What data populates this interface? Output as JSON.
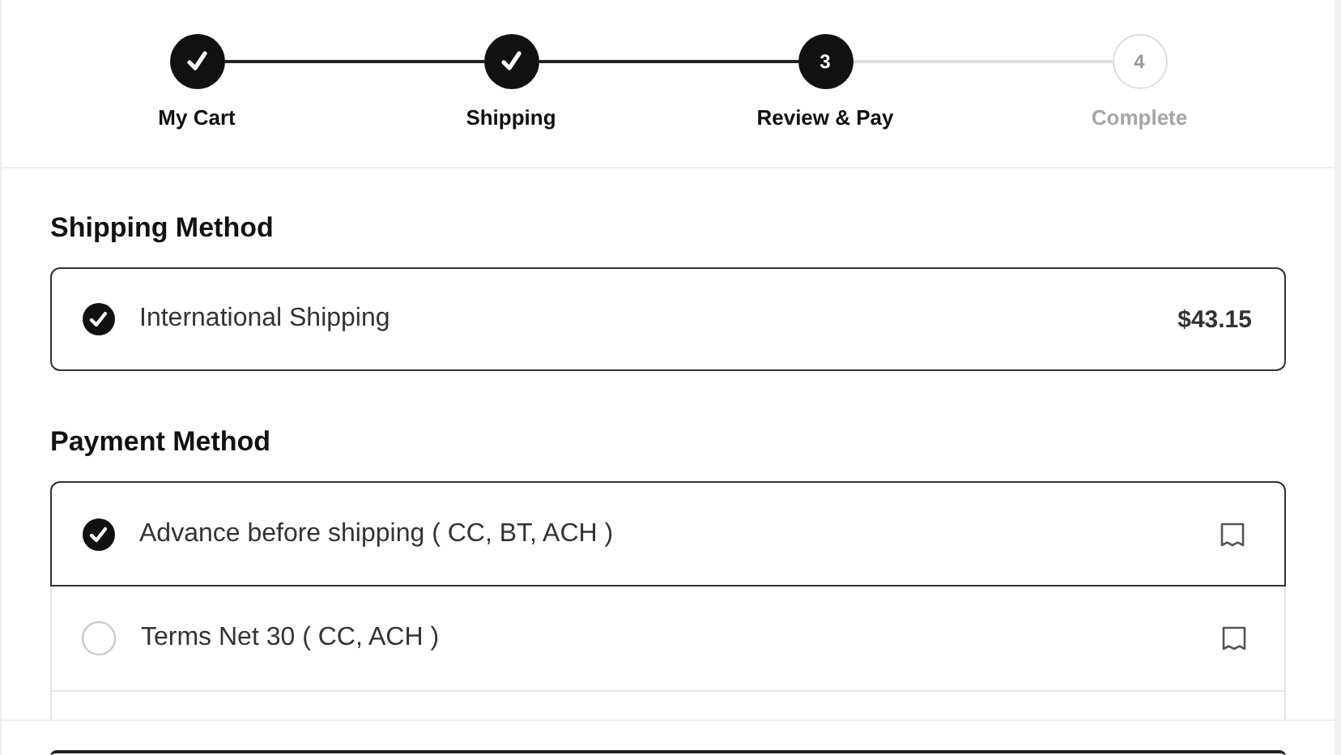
{
  "steps": [
    {
      "label": "My Cart",
      "kind": "done"
    },
    {
      "label": "Shipping",
      "kind": "done"
    },
    {
      "label": "Review & Pay",
      "number": "3",
      "kind": "current"
    },
    {
      "label": "Complete",
      "number": "4",
      "kind": "upcoming"
    }
  ],
  "shipping_method": {
    "heading": "Shipping Method",
    "option": {
      "label": "International Shipping",
      "price": "$43.15",
      "selected": true
    }
  },
  "payment_method": {
    "heading": "Payment Method",
    "options": [
      {
        "label": "Advance before shipping ( CC, BT, ACH )",
        "selected": true
      },
      {
        "label": "Terms Net 30 ( CC, ACH )",
        "selected": false
      }
    ]
  }
}
